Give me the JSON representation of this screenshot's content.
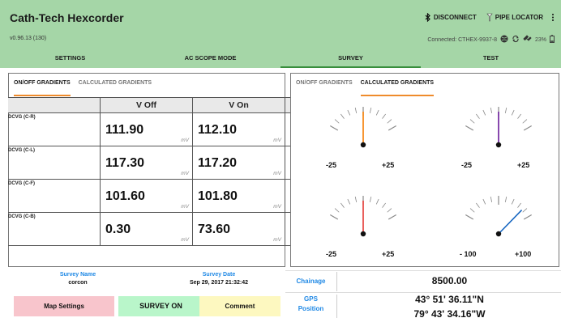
{
  "app": {
    "title": "Cath-Tech Hexcorder",
    "version": "v0.96.13 (130)",
    "disconnect_label": "DISCONNECT",
    "pipe_locator_label": "PIPE LOCATOR",
    "connection_status": "Connected: CTHEX-9937-8",
    "battery_level": "23%"
  },
  "main_tabs": [
    {
      "label": "SETTINGS",
      "active": false
    },
    {
      "label": "AC SCOPE MODE",
      "active": false
    },
    {
      "label": "SURVEY",
      "active": true
    },
    {
      "label": "TEST",
      "active": false
    }
  ],
  "left_subtabs": [
    {
      "label": "ON/OFF GRADIENTS",
      "active": true
    },
    {
      "label": "CALCULATED GRADIENTS",
      "active": false
    }
  ],
  "right_subtabs": [
    {
      "label": "ON/OFF GRADIENTS",
      "active": false
    },
    {
      "label": "CALCULATED GRADIENTS",
      "active": true
    }
  ],
  "table": {
    "headers": [
      "",
      "V Off",
      "V On"
    ],
    "unit": "mV",
    "rows": [
      {
        "label": "DCVG (C-R)",
        "v_off": "111.90",
        "v_on": "112.10"
      },
      {
        "label": "DCVG (C-L)",
        "v_off": "117.30",
        "v_on": "117.20"
      },
      {
        "label": "DCVG (C-F)",
        "v_off": "101.60",
        "v_on": "101.80"
      },
      {
        "label": "DCVG (C-B)",
        "v_off": "0.30",
        "v_on": "73.60"
      }
    ]
  },
  "gauges": [
    {
      "min": "-25",
      "max": "+25",
      "min_value": -25,
      "max_value": 25,
      "value": 0,
      "needle_color": "#f57c00"
    },
    {
      "min": "-25",
      "max": "+25",
      "min_value": -25,
      "max_value": 25,
      "value": 0,
      "needle_color": "#6a1b9a"
    },
    {
      "min": "-25",
      "max": "+25",
      "min_value": -25,
      "max_value": 25,
      "value": 0,
      "needle_color": "#e53935"
    },
    {
      "min": "- 100",
      "max": "+100",
      "min_value": -100,
      "max_value": 100,
      "value": 73.6,
      "needle_color": "#1565c0"
    }
  ],
  "survey": {
    "name_label": "Survey Name",
    "name_value": "corcon",
    "date_label": "Survey Date",
    "date_value": "Sep 29, 2017 21:32:42"
  },
  "buttons": {
    "map_settings": "Map Settings",
    "survey_on": "SURVEY ON",
    "comment": "Comment"
  },
  "info": {
    "chainage_label": "Chainage",
    "chainage_value": "8500.00",
    "gps_label_line1": "GPS",
    "gps_label_line2": "Position",
    "gps_lat": "43° 51' 36.11\"N",
    "gps_lon": "79° 43' 34.16\"W"
  }
}
